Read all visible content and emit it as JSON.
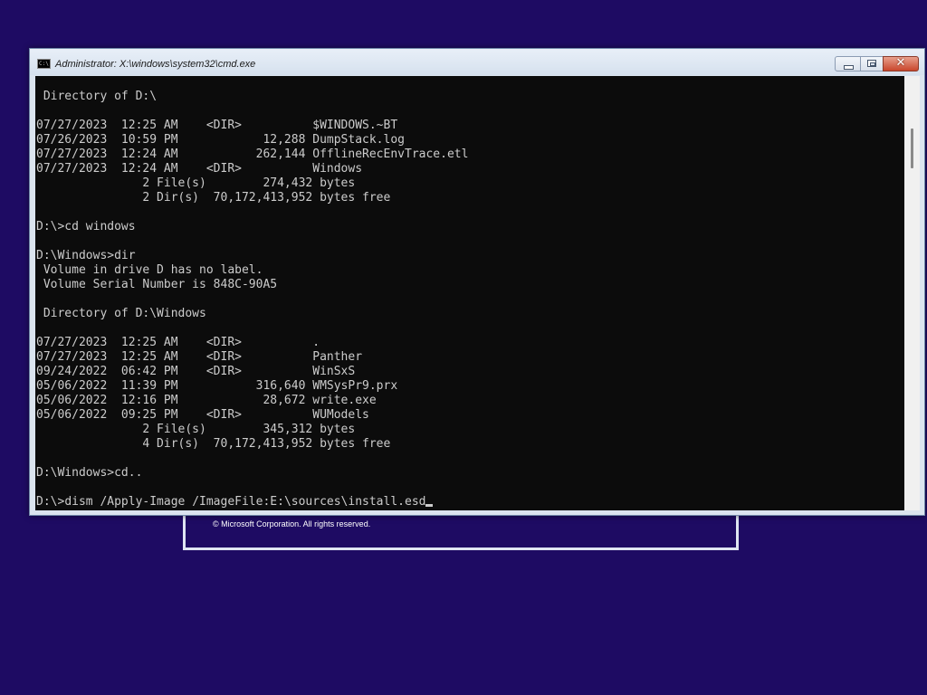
{
  "window": {
    "title": "Administrator: X:\\windows\\system32\\cmd.exe",
    "icon_label": "C:\\",
    "buttons": {
      "minimize": "minimize-icon",
      "maximize": "restore-icon",
      "close": "close-icon",
      "close_glyph": "✕"
    }
  },
  "console": {
    "lines": [
      " Directory of D:\\",
      "",
      "07/27/2023  12:25 AM    <DIR>          $WINDOWS.~BT",
      "07/26/2023  10:59 PM            12,288 DumpStack.log",
      "07/27/2023  12:24 AM           262,144 OfflineRecEnvTrace.etl",
      "07/27/2023  12:24 AM    <DIR>          Windows",
      "               2 File(s)        274,432 bytes",
      "               2 Dir(s)  70,172,413,952 bytes free",
      "",
      "D:\\>cd windows",
      "",
      "D:\\Windows>dir",
      " Volume in drive D has no label.",
      " Volume Serial Number is 848C-90A5",
      "",
      " Directory of D:\\Windows",
      "",
      "07/27/2023  12:25 AM    <DIR>          .",
      "07/27/2023  12:25 AM    <DIR>          Panther",
      "09/24/2022  06:42 PM    <DIR>          WinSxS",
      "05/06/2022  11:39 PM           316,640 WMSysPr9.prx",
      "05/06/2022  12:16 PM            28,672 write.exe",
      "05/06/2022  09:25 PM    <DIR>          WUModels",
      "               2 File(s)        345,312 bytes",
      "               4 Dir(s)  70,172,413,952 bytes free",
      "",
      "D:\\Windows>cd..",
      ""
    ],
    "prompt": "D:\\>",
    "input": "dism /Apply-Image /ImageFile:E:\\sources\\install.esd"
  },
  "background_dialog": {
    "copyright": "© Microsoft Corporation. All rights reserved."
  },
  "colors": {
    "desktop": "#1e0b63",
    "console_bg": "#0c0c0c",
    "console_text": "#cccccc",
    "close_button": "#c9462c"
  }
}
